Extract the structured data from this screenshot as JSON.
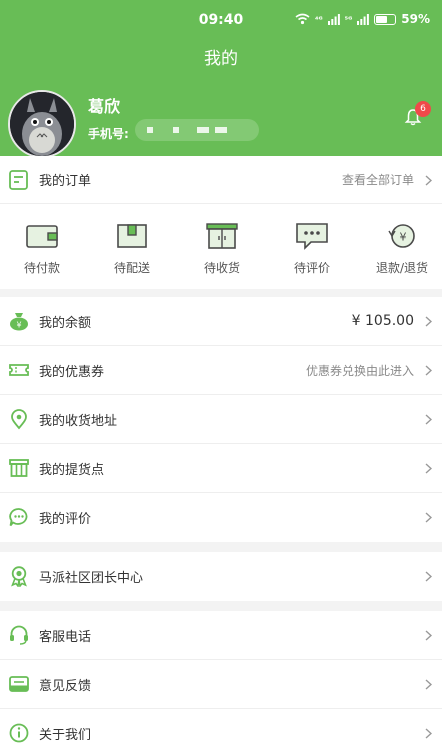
{
  "status_bar": {
    "time": "09:40",
    "network_1": "⁴ᴳ",
    "network_2": "⁵ᴳ",
    "battery": "59%"
  },
  "header": {
    "title": "我的",
    "username": "葛欣",
    "phone_label": "手机号:",
    "notification_count": "6"
  },
  "orders": {
    "title": "我的订单",
    "view_all": "查看全部订单",
    "items": [
      {
        "label": "待付款",
        "icon": "wallet-icon"
      },
      {
        "label": "待配送",
        "icon": "package-icon"
      },
      {
        "label": "待收货",
        "icon": "cabinet-icon"
      },
      {
        "label": "待评价",
        "icon": "comment-icon"
      },
      {
        "label": "退款/退货",
        "icon": "refund-icon"
      }
    ]
  },
  "account": {
    "balance_label": "我的余额",
    "balance_value": "¥ 105.00",
    "coupon_label": "我的优惠券",
    "coupon_hint": "优惠券兑换由此进入",
    "address_label": "我的收货地址",
    "pickup_label": "我的提货点",
    "review_label": "我的评价"
  },
  "community": {
    "leader_label": "马派社区团长中心"
  },
  "service": {
    "phone_label": "客服电话",
    "feedback_label": "意见反馈",
    "about_label": "关于我们"
  },
  "colors": {
    "brand": "#68bd56",
    "badge": "#f04a4a"
  }
}
